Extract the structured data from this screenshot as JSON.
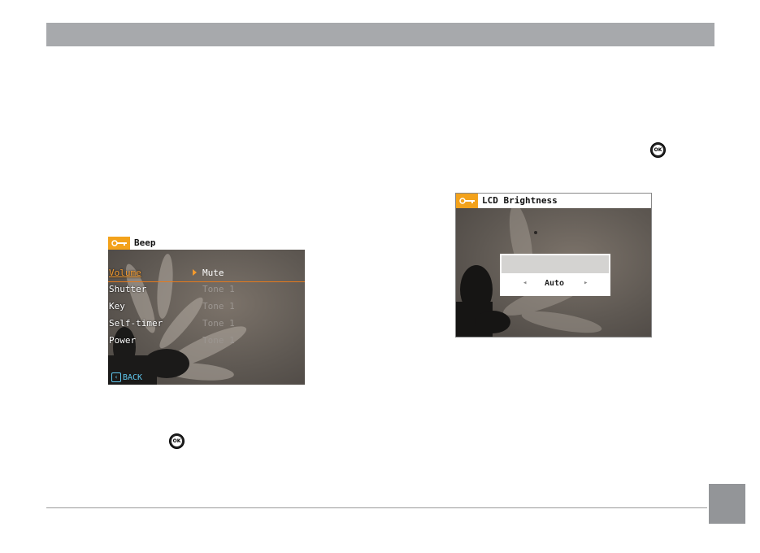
{
  "screen1": {
    "title": "Beep",
    "items": [
      {
        "label": "Volume",
        "value": "Mute"
      },
      {
        "label": "Shutter",
        "value": "Tone 1"
      },
      {
        "label": "Key",
        "value": "Tone 1"
      },
      {
        "label": "Self-timer",
        "value": "Tone 1"
      },
      {
        "label": "Power",
        "value": "Tone 1"
      }
    ],
    "back_label": "BACK"
  },
  "screen2": {
    "title": "LCD Brightness",
    "value": "Auto",
    "left_glyph": "◂",
    "right_glyph": "▸"
  },
  "icons": {
    "ok_label": "OK"
  },
  "colors": {
    "accent": "#f3a21b",
    "back": "#5fc8ef",
    "header": "#a7a9ac"
  }
}
